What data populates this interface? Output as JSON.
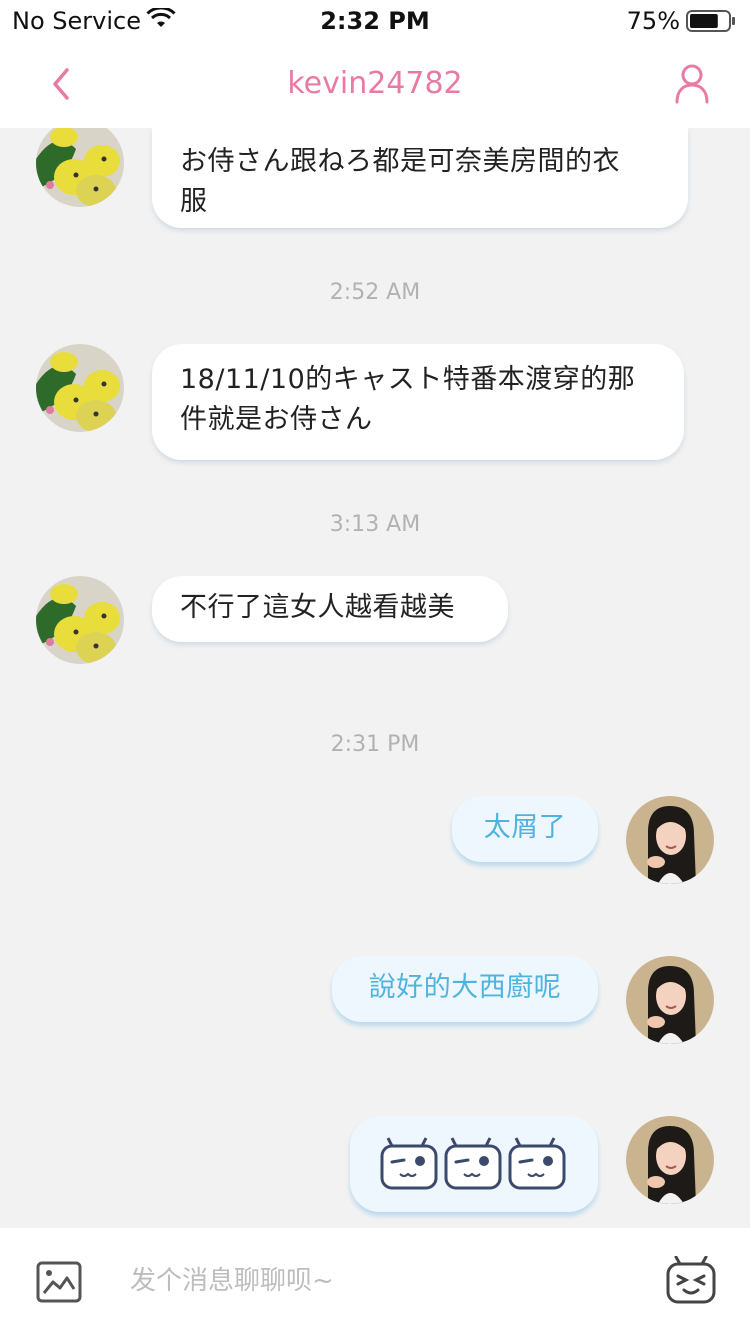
{
  "status_bar": {
    "carrier": "No Service",
    "time": "2:32 PM",
    "battery_percent": "75%",
    "battery_level": 0.75
  },
  "nav": {
    "title": "kevin24782",
    "back_icon": "chevron-left-icon",
    "profile_icon": "user-icon"
  },
  "messages": [
    {
      "side": "in",
      "lines": [
        "お侍さん跟ねろ都是可奈美房間的衣",
        "服"
      ]
    },
    {
      "timestamp": "2:52 AM"
    },
    {
      "side": "in",
      "lines": [
        "18/11/10的キャスト特番本渡穿的那",
        "件就是お侍さん"
      ]
    },
    {
      "timestamp": "3:13 AM"
    },
    {
      "side": "in",
      "lines": [
        "不行了這女人越看越美"
      ]
    },
    {
      "timestamp": "2:31 PM"
    },
    {
      "side": "out",
      "lines": [
        "太屑了"
      ]
    },
    {
      "side": "out",
      "lines": [
        "說好的大西廚呢"
      ]
    },
    {
      "side": "out",
      "type": "emoji",
      "emoji_icon": "tv-face-emoji-icon",
      "count": 3
    }
  ],
  "input": {
    "placeholder": "发个消息聊聊呗~",
    "image_icon": "image-icon",
    "emoji_icon": "tv-emoji-icon"
  },
  "colors": {
    "accent": "#e87ba4",
    "out_text": "#4fb3e0",
    "out_bubble": "#eef7fd",
    "background": "#f2f2f2"
  }
}
